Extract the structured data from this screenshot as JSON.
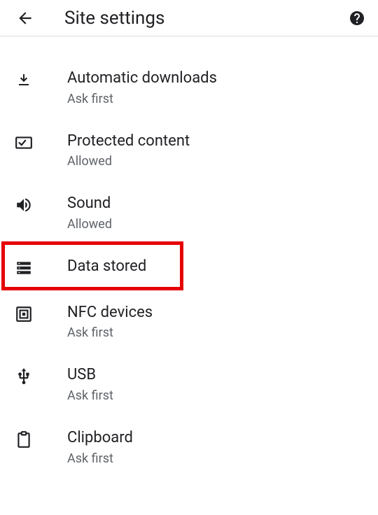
{
  "header": {
    "title": "Site settings"
  },
  "settings": [
    {
      "icon": "download-icon",
      "label": "Automatic downloads",
      "sub": "Ask first"
    },
    {
      "icon": "protected-icon",
      "label": "Protected content",
      "sub": "Allowed"
    },
    {
      "icon": "sound-icon",
      "label": "Sound",
      "sub": "Allowed"
    },
    {
      "icon": "storage-icon",
      "label": "Data stored",
      "sub": ""
    },
    {
      "icon": "nfc-icon",
      "label": "NFC devices",
      "sub": "Ask first"
    },
    {
      "icon": "usb-icon",
      "label": "USB",
      "sub": "Ask first"
    },
    {
      "icon": "clipboard-icon",
      "label": "Clipboard",
      "sub": "Ask first"
    }
  ],
  "highlight": {
    "index": 3
  }
}
